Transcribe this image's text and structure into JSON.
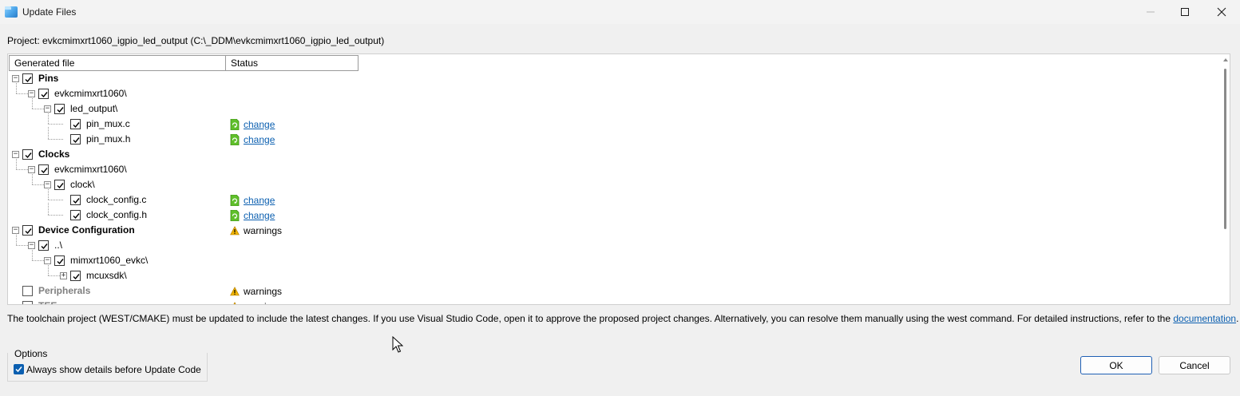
{
  "window": {
    "title": "Update Files"
  },
  "project_line": "Project: evkcmimxrt1060_igpio_led_output (C:\\_DDM\\evkcmimxrt1060_igpio_led_output)",
  "table": {
    "headers": [
      "Generated file",
      "Status"
    ],
    "rows": [
      {
        "label": "Pins",
        "level": 0,
        "bold": true,
        "checked": true,
        "toggle": "-",
        "status": ""
      },
      {
        "label": "evkcmimxrt1060\\",
        "level": 1,
        "checked": true,
        "toggle": "-",
        "status": ""
      },
      {
        "label": "led_output\\",
        "level": 2,
        "checked": true,
        "toggle": "-",
        "status": ""
      },
      {
        "label": "pin_mux.c",
        "level": 3,
        "checked": true,
        "toggle": "",
        "status": "change"
      },
      {
        "label": "pin_mux.h",
        "level": 3,
        "checked": true,
        "toggle": "",
        "status": "change"
      },
      {
        "label": "Clocks",
        "level": 0,
        "bold": true,
        "checked": true,
        "toggle": "-",
        "status": ""
      },
      {
        "label": "evkcmimxrt1060\\",
        "level": 1,
        "checked": true,
        "toggle": "-",
        "status": ""
      },
      {
        "label": "clock\\",
        "level": 2,
        "checked": true,
        "toggle": "-",
        "status": ""
      },
      {
        "label": "clock_config.c",
        "level": 3,
        "checked": true,
        "toggle": "",
        "status": "change"
      },
      {
        "label": "clock_config.h",
        "level": 3,
        "checked": true,
        "toggle": "",
        "status": "change"
      },
      {
        "label": "Device Configuration",
        "level": 0,
        "bold": true,
        "checked": true,
        "toggle": "-",
        "status": "warnings"
      },
      {
        "label": "..\\",
        "level": 1,
        "checked": true,
        "toggle": "-",
        "status": ""
      },
      {
        "label": "mimxrt1060_evkc\\",
        "level": 2,
        "checked": true,
        "toggle": "-",
        "status": ""
      },
      {
        "label": "mcuxsdk\\",
        "level": 3,
        "checked": true,
        "toggle": "+",
        "status": ""
      },
      {
        "label": "Peripherals",
        "level": 0,
        "bold": true,
        "checked": false,
        "gray": true,
        "toggle": "",
        "status": "warnings"
      },
      {
        "label": "TEE",
        "level": 0,
        "bold": true,
        "checked": false,
        "gray": true,
        "toggle": "",
        "status": "warnings"
      }
    ]
  },
  "notice": {
    "text": "The toolchain project (WEST/CMAKE) must be updated to include the latest changes. If you use Visual Studio Code, open it to approve the proposed project changes. Alternatively, you can resolve them manually using the west command. For detailed instructions, refer to the ",
    "link": "documentation",
    "end": "."
  },
  "options": {
    "legend": "Options",
    "always_show_label": "Always show details before Update Code",
    "always_show_checked": true
  },
  "buttons": {
    "ok": "OK",
    "cancel": "Cancel"
  },
  "colors": {
    "link": "#0b5fb0",
    "accent": "#1f5fb4",
    "change_icon": "#5fbf2a",
    "warn_icon": "#f0b400"
  }
}
